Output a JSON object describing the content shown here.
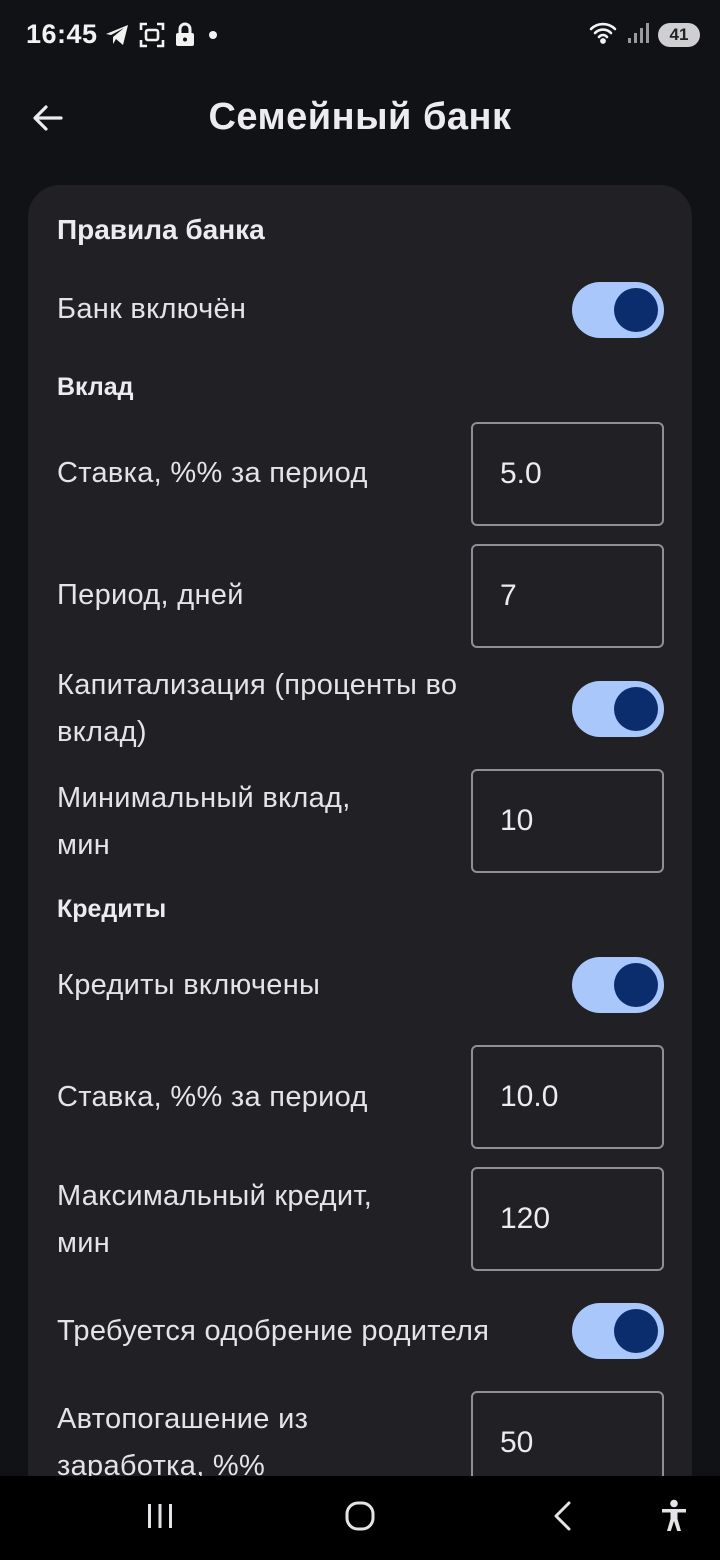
{
  "status_bar": {
    "time": "16:45",
    "battery": "41",
    "icons": [
      "telegram-icon",
      "face-scan-icon",
      "lock-icon",
      "notification-dot-icon",
      "wifi-icon",
      "signal-icon",
      "battery-icon"
    ]
  },
  "header": {
    "title": "Семейный банк",
    "back_icon": "arrow-left-icon"
  },
  "card": {
    "title": "Правила банка",
    "bank_enabled": {
      "label": "Банк включён",
      "on": true
    },
    "deposit": {
      "heading": "Вклад",
      "rate": {
        "label": "Ставка, %% за период",
        "value": "5.0"
      },
      "period": {
        "label": "Период, дней",
        "value": "7"
      },
      "capitalization": {
        "label_line1": "Капитализация (проценты во",
        "label_line2": "вклад)",
        "on": true
      },
      "min_deposit": {
        "label_line1": "Минимальный вклад,",
        "label_line2": "мин",
        "value": "10"
      }
    },
    "credits": {
      "heading": "Кредиты",
      "enabled": {
        "label": "Кредиты включены",
        "on": true
      },
      "rate": {
        "label": "Ставка, %% за период",
        "value": "10.0"
      },
      "max_credit": {
        "label_line1": "Максимальный кредит,",
        "label_line2": "мин",
        "value": "120"
      },
      "parent_approval": {
        "label": "Требуется одобрение родителя",
        "on": true
      },
      "auto_repay": {
        "label_line1": "Автопогашение из",
        "label_line2": "заработка, %%",
        "value": "50"
      }
    }
  },
  "nav_bar": {
    "icons": [
      "recent-apps-icon",
      "home-icon",
      "back-icon",
      "accessibility-icon"
    ]
  },
  "colors": {
    "background": "#111215",
    "card": "#202025",
    "toggle_track": "#a9c7fb",
    "toggle_knob": "#0b2d6e"
  }
}
